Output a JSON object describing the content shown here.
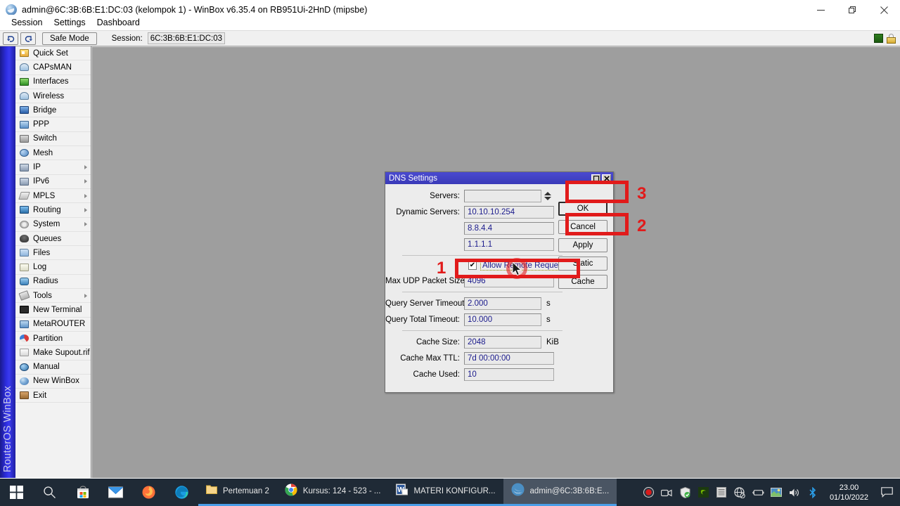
{
  "window": {
    "title": "admin@6C:3B:6B:E1:DC:03 (kelompok 1) - WinBox v6.35.4 on RB951Ui-2HnD (mipsbe)",
    "icon": "winbox-icon",
    "minimize_label": "—",
    "restore_label": "❐",
    "close_label": "✕"
  },
  "menubar": {
    "items": [
      {
        "label": "Session",
        "name": "menu-session"
      },
      {
        "label": "Settings",
        "name": "menu-settings"
      },
      {
        "label": "Dashboard",
        "name": "menu-dashboard"
      }
    ]
  },
  "toolbar": {
    "undo_label": "↶",
    "redo_label": "↷",
    "safe_mode_label": "Safe Mode",
    "session_label": "Session:",
    "session_value": "6C:3B:6B:E1:DC:03"
  },
  "sidebar": {
    "vertical_brand": "RouterOS WinBox",
    "items": [
      {
        "label": "Quick Set",
        "icon": "quickset-icon",
        "icon_class": "i-quickset",
        "submenu": false
      },
      {
        "label": "CAPsMAN",
        "icon": "capsman-icon",
        "icon_class": "i-capsman",
        "submenu": false
      },
      {
        "label": "Interfaces",
        "icon": "interfaces-icon",
        "icon_class": "i-inter",
        "submenu": false
      },
      {
        "label": "Wireless",
        "icon": "wireless-icon",
        "icon_class": "i-wireless",
        "submenu": false
      },
      {
        "label": "Bridge",
        "icon": "bridge-icon",
        "icon_class": "i-bridge",
        "submenu": false
      },
      {
        "label": "PPP",
        "icon": "ppp-icon",
        "icon_class": "i-ppp",
        "submenu": false
      },
      {
        "label": "Switch",
        "icon": "switch-icon",
        "icon_class": "i-switch",
        "submenu": false
      },
      {
        "label": "Mesh",
        "icon": "mesh-icon",
        "icon_class": "i-mesh",
        "submenu": false
      },
      {
        "label": "IP",
        "icon": "ip-icon",
        "icon_class": "i-ip",
        "submenu": true
      },
      {
        "label": "IPv6",
        "icon": "ipv6-icon",
        "icon_class": "i-ipv6",
        "submenu": true
      },
      {
        "label": "MPLS",
        "icon": "mpls-icon",
        "icon_class": "i-mpls",
        "submenu": true
      },
      {
        "label": "Routing",
        "icon": "routing-icon",
        "icon_class": "i-routing",
        "submenu": true
      },
      {
        "label": "System",
        "icon": "system-icon",
        "icon_class": "i-system",
        "submenu": true
      },
      {
        "label": "Queues",
        "icon": "queues-icon",
        "icon_class": "i-queues",
        "submenu": false
      },
      {
        "label": "Files",
        "icon": "files-icon",
        "icon_class": "i-files",
        "submenu": false
      },
      {
        "label": "Log",
        "icon": "log-icon",
        "icon_class": "i-log",
        "submenu": false
      },
      {
        "label": "Radius",
        "icon": "radius-icon",
        "icon_class": "i-radius",
        "submenu": false
      },
      {
        "label": "Tools",
        "icon": "tools-icon",
        "icon_class": "i-tools",
        "submenu": true
      },
      {
        "label": "New Terminal",
        "icon": "terminal-icon",
        "icon_class": "i-term",
        "submenu": false
      },
      {
        "label": "MetaROUTER",
        "icon": "metarouter-icon",
        "icon_class": "i-meta",
        "submenu": false
      },
      {
        "label": "Partition",
        "icon": "partition-icon",
        "icon_class": "i-part",
        "submenu": false
      },
      {
        "label": "Make Supout.rif",
        "icon": "supout-icon",
        "icon_class": "i-supout",
        "submenu": false
      },
      {
        "label": "Manual",
        "icon": "manual-icon",
        "icon_class": "i-manual",
        "submenu": false
      },
      {
        "label": "New WinBox",
        "icon": "newwinbox-icon",
        "icon_class": "i-newwb",
        "submenu": false
      },
      {
        "label": "Exit",
        "icon": "exit-icon",
        "icon_class": "i-exit",
        "submenu": false
      }
    ]
  },
  "dialog": {
    "title": "DNS Settings",
    "restore_label": "❐",
    "close_label": "✕",
    "fields": {
      "servers_label": "Servers:",
      "servers_value": "",
      "dynamic_servers_label": "Dynamic Servers:",
      "dynamic_servers": [
        "10.10.10.254",
        "8.8.4.4",
        "1.1.1.1"
      ],
      "allow_remote_requests_label": "Allow Remote Requests",
      "allow_remote_requests_checked": "✔",
      "max_udp_label": "Max UDP Packet Size:",
      "max_udp_value": "4096",
      "query_server_timeout_label": "Query Server Timeout:",
      "query_server_timeout_value": "2.000",
      "query_server_timeout_unit": "s",
      "query_total_timeout_label": "Query Total Timeout:",
      "query_total_timeout_value": "10.000",
      "query_total_timeout_unit": "s",
      "cache_size_label": "Cache Size:",
      "cache_size_value": "2048",
      "cache_size_unit": "KiB",
      "cache_max_ttl_label": "Cache Max TTL:",
      "cache_max_ttl_value": "7d 00:00:00",
      "cache_used_label": "Cache Used:",
      "cache_used_value": "10"
    },
    "buttons": {
      "ok": "OK",
      "cancel": "Cancel",
      "apply": "Apply",
      "static": "Static",
      "cache": "Cache"
    },
    "annotations": {
      "step1": "1",
      "step2": "2",
      "step3": "3"
    }
  },
  "taskbar": {
    "start_icon": "windows-start-icon",
    "search_icon": "search-icon",
    "store_icon": "microsoft-store-icon",
    "mail_icon": "mail-icon",
    "firefox_icon": "firefox-icon",
    "edge_icon": "edge-icon",
    "windows": [
      {
        "label": "Pertemuan 2",
        "icon": "folder-icon",
        "active": false,
        "underline": true
      },
      {
        "label": "Kursus: 124 - 523 - ...",
        "icon": "chrome-icon",
        "active": false,
        "underline": true
      },
      {
        "label": "MATERI KONFIGUR...",
        "icon": "word-icon",
        "active": false,
        "underline": true
      },
      {
        "label": "admin@6C:3B:6B:E...",
        "icon": "winbox-icon",
        "active": true,
        "underline": true
      }
    ],
    "tray": [
      {
        "icon": "record-icon"
      },
      {
        "icon": "screen-record-icon"
      },
      {
        "icon": "windows-security-icon"
      },
      {
        "icon": "nvidia-icon"
      },
      {
        "icon": "list-icon"
      },
      {
        "icon": "network-globe-icon"
      },
      {
        "icon": "battery-icon"
      },
      {
        "icon": "display-icon"
      },
      {
        "icon": "volume-icon"
      },
      {
        "icon": "bluetooth-icon"
      }
    ],
    "clock_time": "23.00",
    "clock_date": "01/10/2022",
    "notification_icon": "notification-icon"
  },
  "colors": {
    "canvas": "#9e9e9e",
    "sidebar_band": "#2d2de0",
    "dialog_title": "#4a4ad0",
    "annotation_red": "#e11b1b",
    "taskbar": "#1f2a36"
  }
}
